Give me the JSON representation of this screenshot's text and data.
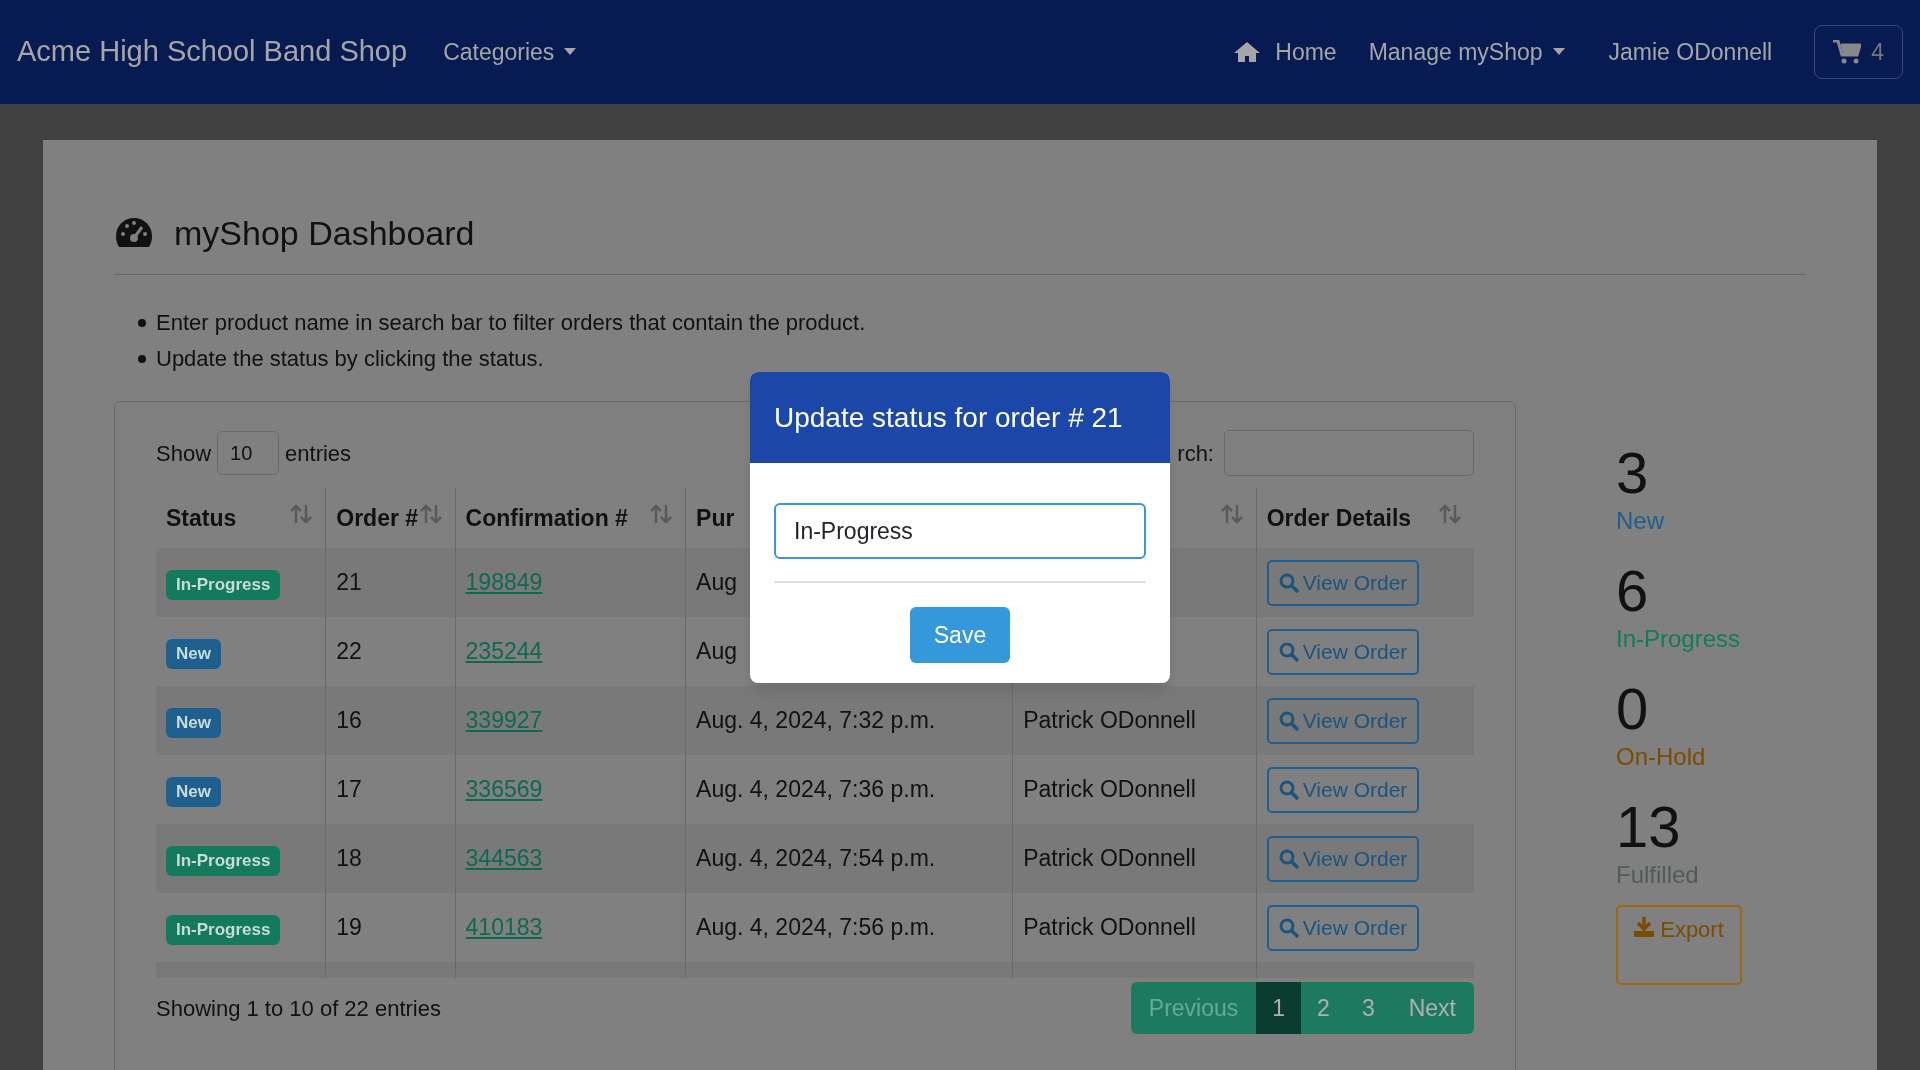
{
  "navbar": {
    "brand": "Acme High School Band Shop",
    "menu": [
      {
        "label": "Categories",
        "kind": "dropdown"
      }
    ],
    "right": [
      {
        "kind": "home",
        "label": "Home"
      },
      {
        "kind": "dropdown",
        "label": "Manage myShop"
      },
      {
        "kind": "text",
        "label": "Jamie ODonnell"
      }
    ],
    "cart_count": "4"
  },
  "page": {
    "title": "myShop Dashboard",
    "instructions": [
      "Enter product name in search bar to filter orders that contain the product.",
      "Update the status by clicking the status."
    ]
  },
  "table": {
    "show_label": "Show",
    "page_size": "10",
    "entries_label": "entries",
    "search_label": "rch:",
    "columns": [
      {
        "label": "Status",
        "sort_icon": true
      },
      {
        "label": "Order #",
        "sort_icon": true
      },
      {
        "label": "Confirmation #",
        "sort_icon": true
      },
      {
        "label": "Pur",
        "sort_icon": false
      },
      {
        "sort_icon": true
      },
      {
        "label": "Order Details",
        "sort_icon": true
      }
    ],
    "rows": [
      {
        "status": "In-Progress",
        "color": "#137a5e",
        "order": "21",
        "confirmation": "198849",
        "purchased": "Aug",
        "action": "View Order"
      },
      {
        "status": "New",
        "color": "#1e5f8f",
        "order": "22",
        "confirmation": "235244",
        "purchased": "Aug",
        "action": "View Order"
      },
      {
        "status": "New",
        "color": "#1e5f8f",
        "order": "16",
        "confirmation": "339927",
        "purchased": "Aug. 4, 2024, 7:32 p.m.",
        "customer": "Patrick ODonnell",
        "action": "View Order"
      },
      {
        "status": "New",
        "color": "#1e5f8f",
        "order": "17",
        "confirmation": "336569",
        "purchased": "Aug. 4, 2024, 7:36 p.m.",
        "customer": "Patrick ODonnell",
        "action": "View Order"
      },
      {
        "status": "In-Progress",
        "color": "#137a5e",
        "order": "18",
        "confirmation": "344563",
        "purchased": "Aug. 4, 2024, 7:54 p.m.",
        "customer": "Patrick ODonnell",
        "action": "View Order"
      },
      {
        "status": "In-Progress",
        "color": "#137a5e",
        "order": "19",
        "confirmation": "410183",
        "purchased": "Aug. 4, 2024, 7:56 p.m.",
        "customer": "Patrick ODonnell",
        "action": "View Order"
      }
    ],
    "info": "Showing 1 to 10 of 22 entries",
    "pagination": [
      {
        "label": "Previous",
        "kind": "prev",
        "disabled": true,
        "selected": false
      },
      {
        "label": "1",
        "kind": "page",
        "disabled": false,
        "selected": true
      },
      {
        "label": "2",
        "kind": "page",
        "disabled": false,
        "selected": false
      },
      {
        "label": "3",
        "kind": "page",
        "disabled": false,
        "selected": false
      },
      {
        "label": "Next",
        "kind": "next",
        "disabled": false,
        "selected": false
      }
    ]
  },
  "stats": [
    {
      "count": "3",
      "label": "New",
      "color": "#1e5f8f"
    },
    {
      "count": "6",
      "label": "In-Progress",
      "color": "#137a5e"
    },
    {
      "count": "0",
      "label": "On-Hold",
      "color": "#7a4c00"
    },
    {
      "count": "13",
      "label": "Fulfilled",
      "color": "#525a5b"
    }
  ],
  "export_button": {
    "label": "Export"
  },
  "modal": {
    "title": "Update status for order # 21",
    "value": "In-Progress",
    "save": "Save"
  }
}
